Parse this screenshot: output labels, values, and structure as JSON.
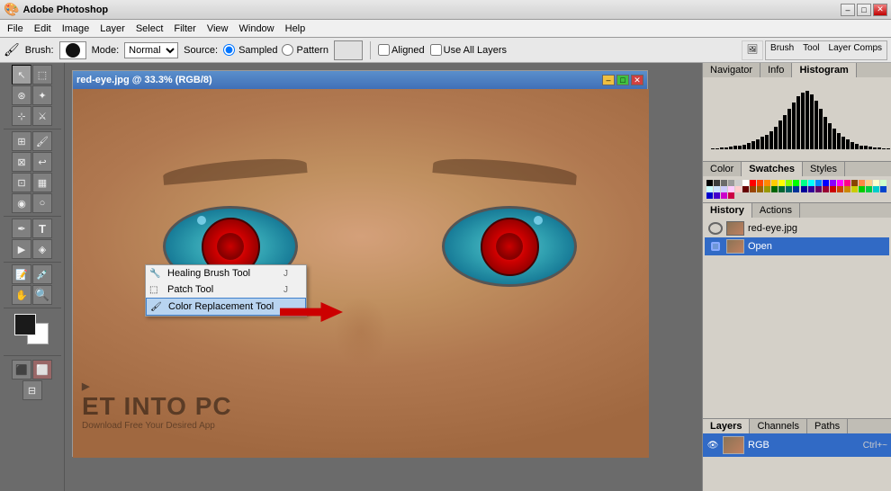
{
  "app": {
    "title": "Adobe Photoshop",
    "icon": "🎨"
  },
  "titlebar": {
    "title": "Adobe Photoshop",
    "btn_min": "–",
    "btn_max": "□",
    "btn_close": "✕"
  },
  "menubar": {
    "items": [
      "File",
      "Edit",
      "Image",
      "Layer",
      "Select",
      "Filter",
      "View",
      "Window",
      "Help"
    ]
  },
  "optionsbar": {
    "brush_label": "Brush:",
    "brush_size": "19",
    "mode_label": "Mode:",
    "mode_value": "Normal",
    "source_label": "Source:",
    "sampled_label": "Sampled",
    "pattern_label": "Pattern",
    "aligned_label": "Aligned",
    "use_all_layers_label": "Use All Layers"
  },
  "right_panel_icons": {
    "icon1": "🖼",
    "icon2": "🖌",
    "icon3": "📋"
  },
  "right_tabs_top": {
    "tabs": [
      "Brush",
      "Tool",
      "Layer Comps"
    ]
  },
  "histogram": {
    "tabs": [
      "Navigator",
      "Info",
      "Histogram"
    ],
    "active_tab": "Histogram",
    "bars": [
      1,
      1,
      2,
      2,
      3,
      4,
      5,
      6,
      8,
      10,
      12,
      15,
      18,
      22,
      28,
      35,
      42,
      50,
      58,
      65,
      70,
      72,
      68,
      60,
      50,
      40,
      32,
      25,
      20,
      16,
      12,
      9,
      7,
      5,
      4,
      3,
      2,
      2,
      1,
      1
    ]
  },
  "color_panel": {
    "tabs": [
      "Color",
      "Swatches",
      "Styles"
    ],
    "active_tab": "Swatches",
    "swatches": [
      "#000000",
      "#3b3b3b",
      "#6b6b6b",
      "#9b9b9b",
      "#cbcbcb",
      "#ffffff",
      "#ff0000",
      "#ff4400",
      "#ff8800",
      "#ffcc00",
      "#ffff00",
      "#88ff00",
      "#00ff00",
      "#00ff88",
      "#00ffff",
      "#0088ff",
      "#0000ff",
      "#8800ff",
      "#ff00ff",
      "#ff0088",
      "#884400",
      "#ff8844",
      "#ffcc88",
      "#ffffcc",
      "#ccffcc",
      "#ccffff",
      "#cce4ff",
      "#ccccff",
      "#ffccff",
      "#ffcccc",
      "#660000",
      "#994400",
      "#996600",
      "#999900",
      "#006600",
      "#006633",
      "#006666",
      "#003399",
      "#000099",
      "#330099",
      "#660066",
      "#990033",
      "#cc0000",
      "#cc4400",
      "#cc8800",
      "#cccc00",
      "#00cc00",
      "#00cc44",
      "#00cccc",
      "#0044cc",
      "#0000cc",
      "#4400cc",
      "#cc00cc",
      "#cc0044"
    ]
  },
  "history_panel": {
    "tabs": [
      "History",
      "Actions"
    ],
    "active_tab": "History",
    "items": [
      {
        "label": "red-eye.jpg",
        "type": "snapshot"
      },
      {
        "label": "Open",
        "type": "action",
        "active": true
      }
    ]
  },
  "layers_panel": {
    "tabs": [
      "Layers",
      "Channels",
      "Paths"
    ],
    "active_tab": "Layers",
    "layers": [
      {
        "name": "RGB",
        "shortcut": "Ctrl+~",
        "active": true
      }
    ]
  },
  "document": {
    "title": "red-eye.jpg @ 33.3% (RGB/8)",
    "zoom": "33.3%",
    "mode": "RGB/8"
  },
  "context_menu": {
    "items": [
      {
        "label": "Healing Brush Tool",
        "shortcut": "J",
        "icon": "🔧"
      },
      {
        "label": "Patch Tool",
        "shortcut": "J",
        "icon": "🩹"
      },
      {
        "label": "Color Replacement Tool",
        "shortcut": "",
        "icon": "🖌",
        "highlighted": true
      }
    ]
  },
  "watermark": {
    "line1": "ET INTO PC",
    "line2": "Download Free Your Desired App"
  },
  "toolbar": {
    "tools": [
      "↗",
      "✂",
      "⬚",
      "⚯",
      "⊹",
      "✏",
      "🖌",
      "🔲",
      "Ω",
      "T",
      "✒",
      "◈",
      "🔍",
      "🤚",
      "🪣",
      "🔷",
      "⬛",
      "⬜"
    ]
  }
}
